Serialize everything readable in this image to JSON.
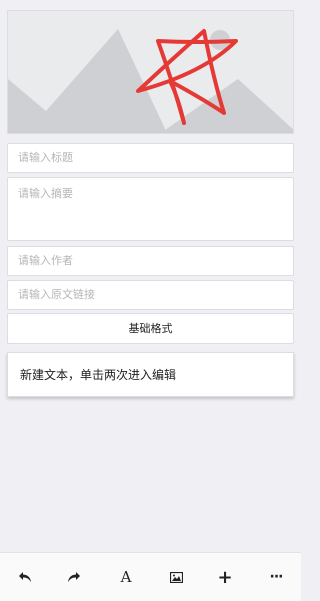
{
  "cover": {
    "icon": "image-placeholder"
  },
  "form": {
    "title_placeholder": "请输入标题",
    "summary_placeholder": "请输入摘要",
    "author_placeholder": "请输入作者",
    "link_placeholder": "请输入原文链接"
  },
  "format_button": {
    "label": "基础格式"
  },
  "content": {
    "text_block": "新建文本，单击两次进入编辑"
  },
  "toolbar": {
    "undo_icon": "undo-icon",
    "redo_icon": "redo-icon",
    "font_glyph": "A",
    "image_icon": "image-icon",
    "add_glyph": "+",
    "more_glyph": "···"
  },
  "colors": {
    "background": "#efeff4",
    "star_stroke": "#e53935",
    "placeholder_shape": "#cfd0d3"
  }
}
